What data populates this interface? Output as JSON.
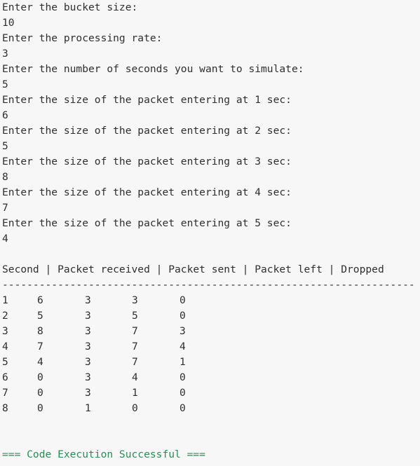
{
  "io": [
    {
      "prompt": "Enter the bucket size:",
      "value": "10"
    },
    {
      "prompt": "Enter the processing rate:",
      "value": "3"
    },
    {
      "prompt": "Enter the number of seconds you want to simulate:",
      "value": "5"
    },
    {
      "prompt": "Enter the size of the packet entering at 1 sec:",
      "value": "6"
    },
    {
      "prompt": "Enter the size of the packet entering at 2 sec:",
      "value": "5"
    },
    {
      "prompt": "Enter the size of the packet entering at 3 sec:",
      "value": "8"
    },
    {
      "prompt": "Enter the size of the packet entering at 4 sec:",
      "value": "7"
    },
    {
      "prompt": "Enter the size of the packet entering at 5 sec:",
      "value": "4"
    }
  ],
  "table": {
    "header": "Second | Packet received | Packet sent | Packet left | Dropped",
    "divider": "---------------------------------------------------------------------",
    "rows": [
      [
        "1",
        "6",
        "3",
        "3",
        "0"
      ],
      [
        "2",
        "5",
        "3",
        "5",
        "0"
      ],
      [
        "3",
        "8",
        "3",
        "7",
        "3"
      ],
      [
        "4",
        "7",
        "3",
        "7",
        "4"
      ],
      [
        "5",
        "4",
        "3",
        "7",
        "1"
      ],
      [
        "6",
        "0",
        "3",
        "4",
        "0"
      ],
      [
        "7",
        "0",
        "3",
        "1",
        "0"
      ],
      [
        "8",
        "0",
        "1",
        "0",
        "0"
      ]
    ]
  },
  "status": "=== Code Execution Successful ===",
  "colors": {
    "background": "#f7f7f7",
    "text": "#2f2f2f",
    "success": "#2e8b57"
  }
}
